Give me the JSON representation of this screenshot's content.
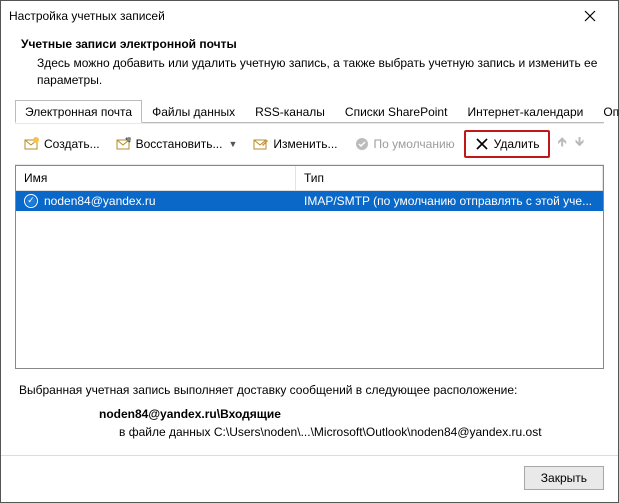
{
  "titlebar": {
    "title": "Настройка учетных записей"
  },
  "header": {
    "title": "Учетные записи электронной почты",
    "desc": "Здесь можно добавить или удалить учетную запись, а также выбрать учетную запись и изменить ее параметры."
  },
  "tabs": {
    "items": [
      {
        "label": "Электронная почта"
      },
      {
        "label": "Файлы данных"
      },
      {
        "label": "RSS-каналы"
      },
      {
        "label": "Списки SharePoint"
      },
      {
        "label": "Интернет-календари"
      },
      {
        "label": "Опублико"
      }
    ]
  },
  "toolbar": {
    "create": "Создать...",
    "restore": "Восстановить...",
    "edit": "Изменить...",
    "default": "По умолчанию",
    "delete": "Удалить"
  },
  "table": {
    "headers": {
      "name": "Имя",
      "type": "Тип"
    },
    "rows": [
      {
        "name": "noden84@yandex.ru",
        "type": "IMAP/SMTP (по умолчанию отправлять с этой уче..."
      }
    ]
  },
  "footer": {
    "line1": "Выбранная учетная запись выполняет доставку сообщений в следующее расположение:",
    "line2": "noden84@yandex.ru\\Входящие",
    "line3": "в файле данных C:\\Users\\noden\\...\\Microsoft\\Outlook\\noden84@yandex.ru.ost"
  },
  "dialog": {
    "close": "Закрыть"
  }
}
